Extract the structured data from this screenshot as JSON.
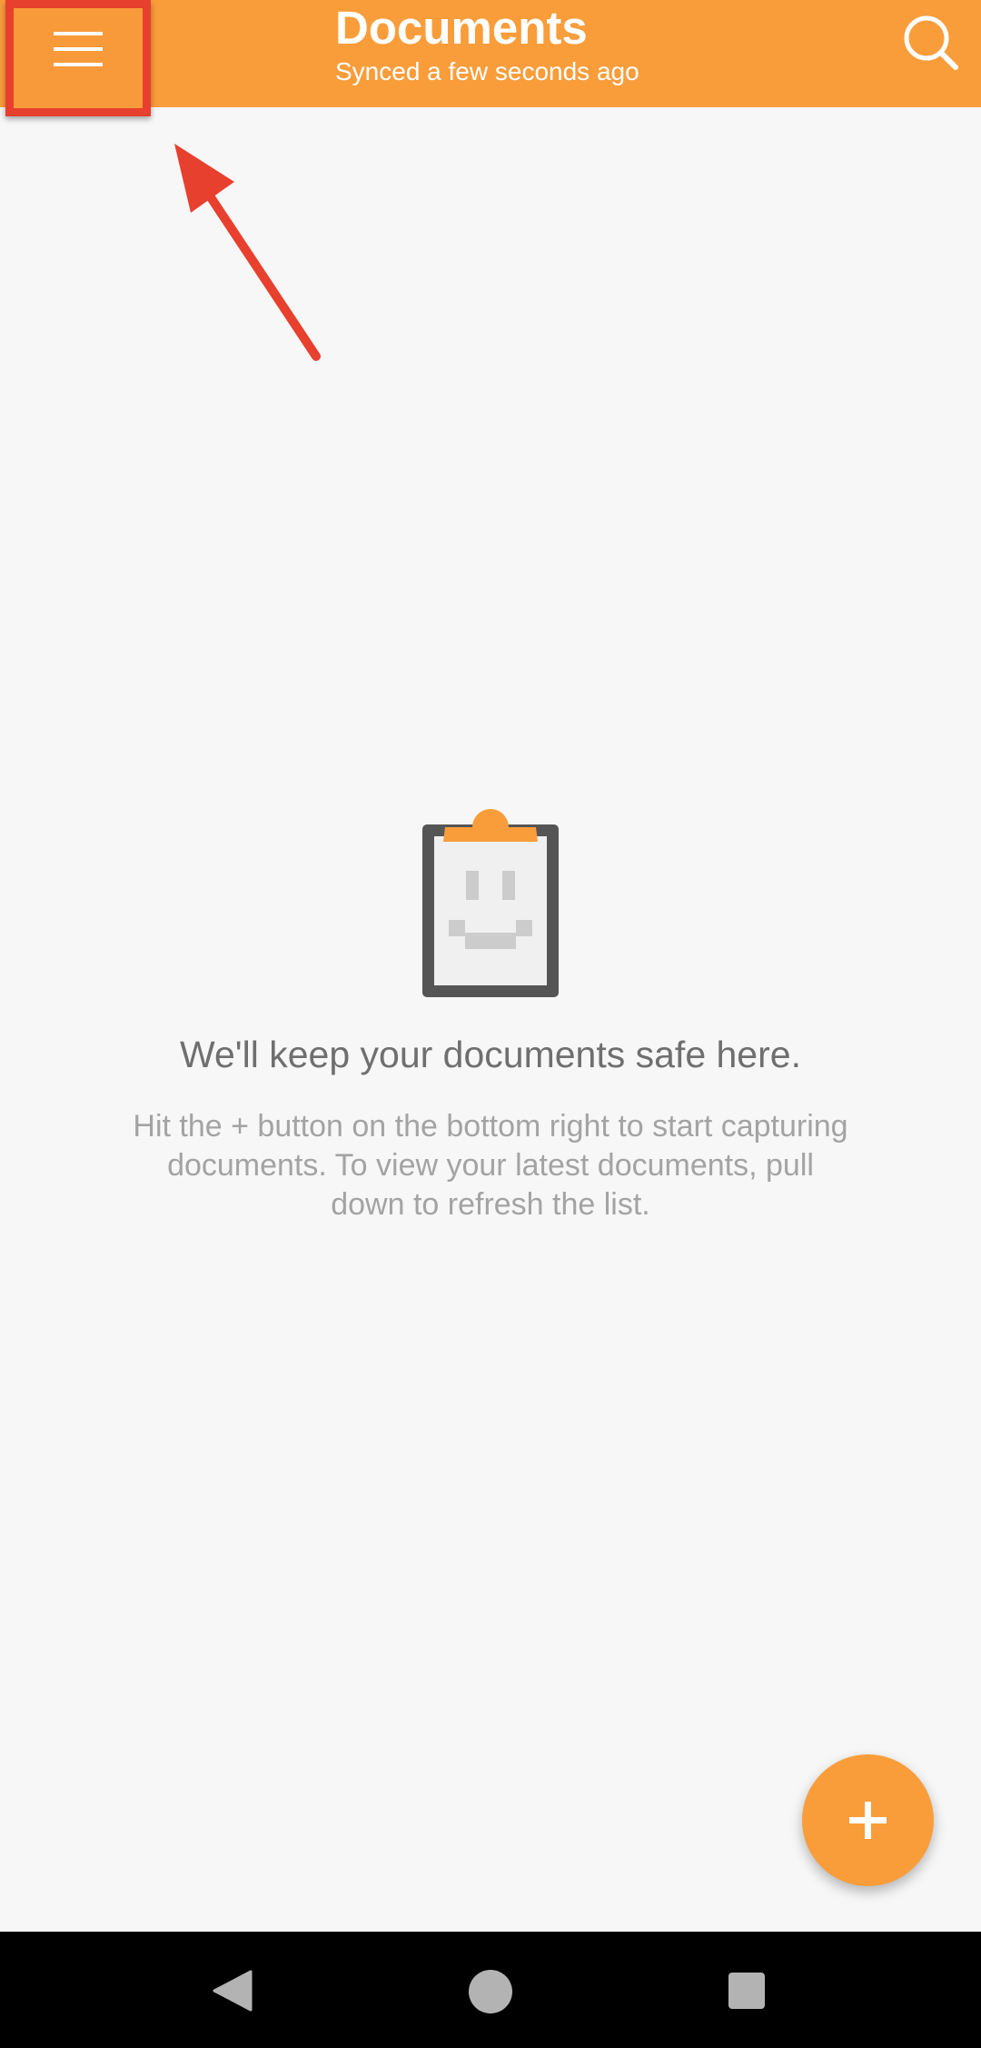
{
  "appbar": {
    "title": "Documents",
    "subtitle": "Synced a few seconds ago",
    "menu_icon": "hamburger-menu-icon",
    "search_icon": "search-icon",
    "background_color": "#f99d3b"
  },
  "annotation": {
    "highlight_color": "#e8402e",
    "arrow_icon": "annotation-arrow-icon"
  },
  "empty_state": {
    "icon": "clipboard-smiley-icon",
    "title": "We'll keep your documents safe here.",
    "body": "Hit the + button on the bottom right to start capturing documents. To view your latest documents, pull down to refresh the list."
  },
  "fab": {
    "icon": "plus-icon",
    "color": "#f99d3b"
  },
  "navbar": {
    "back_icon": "back-triangle-icon",
    "home_icon": "home-circle-icon",
    "recents_icon": "recents-square-icon"
  }
}
